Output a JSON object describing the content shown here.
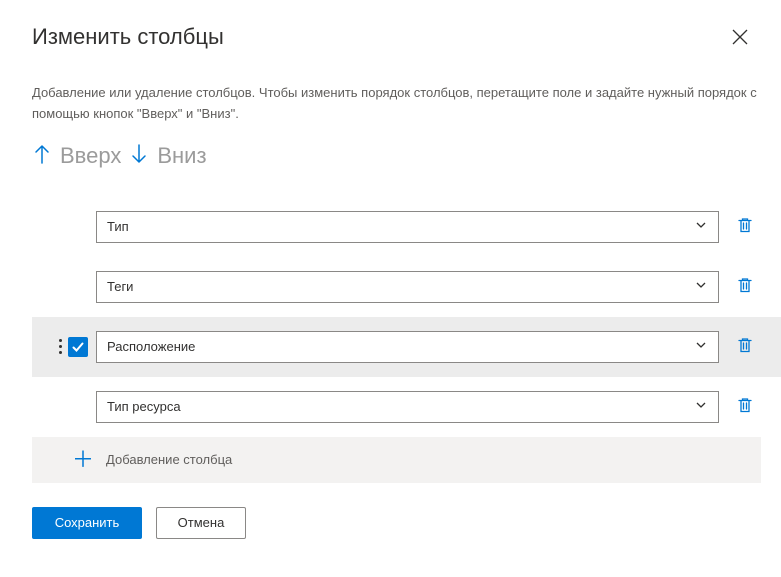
{
  "title": "Изменить столбцы",
  "description": "Добавление или удаление столбцов. Чтобы изменить порядок столбцов, перетащите поле и задайте нужный порядок с помощью кнопок \"Вверх\" и \"Вниз\".",
  "upLabel": "Вверх",
  "downLabel": "Вниз",
  "rows": [
    {
      "label": "Тип",
      "selected": false
    },
    {
      "label": "Теги",
      "selected": false
    },
    {
      "label": "Расположение",
      "selected": true
    },
    {
      "label": "Тип ресурса",
      "selected": false
    }
  ],
  "addColumn": "Добавление столбца",
  "save": "Сохранить",
  "cancel": "Отмена"
}
